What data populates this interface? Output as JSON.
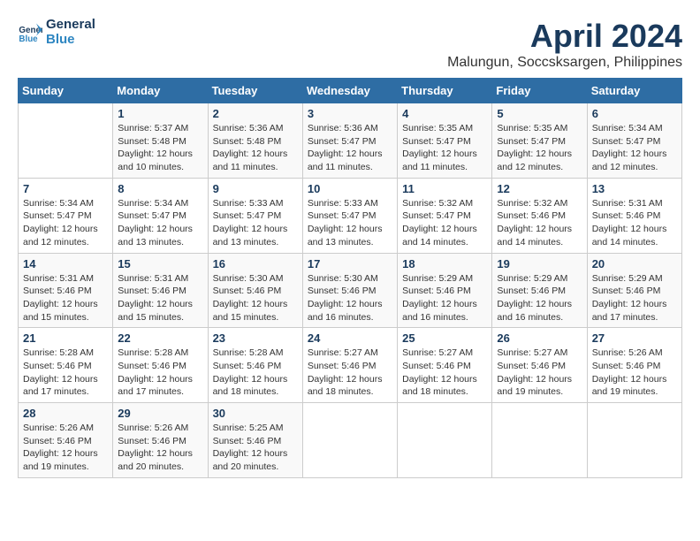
{
  "header": {
    "logo_line1": "General",
    "logo_line2": "Blue",
    "month": "April 2024",
    "location": "Malungun, Soccsksargen, Philippines"
  },
  "weekdays": [
    "Sunday",
    "Monday",
    "Tuesday",
    "Wednesday",
    "Thursday",
    "Friday",
    "Saturday"
  ],
  "weeks": [
    [
      {
        "day": "",
        "sunrise": "",
        "sunset": "",
        "daylight": ""
      },
      {
        "day": "1",
        "sunrise": "Sunrise: 5:37 AM",
        "sunset": "Sunset: 5:48 PM",
        "daylight": "Daylight: 12 hours and 10 minutes."
      },
      {
        "day": "2",
        "sunrise": "Sunrise: 5:36 AM",
        "sunset": "Sunset: 5:48 PM",
        "daylight": "Daylight: 12 hours and 11 minutes."
      },
      {
        "day": "3",
        "sunrise": "Sunrise: 5:36 AM",
        "sunset": "Sunset: 5:47 PM",
        "daylight": "Daylight: 12 hours and 11 minutes."
      },
      {
        "day": "4",
        "sunrise": "Sunrise: 5:35 AM",
        "sunset": "Sunset: 5:47 PM",
        "daylight": "Daylight: 12 hours and 11 minutes."
      },
      {
        "day": "5",
        "sunrise": "Sunrise: 5:35 AM",
        "sunset": "Sunset: 5:47 PM",
        "daylight": "Daylight: 12 hours and 12 minutes."
      },
      {
        "day": "6",
        "sunrise": "Sunrise: 5:34 AM",
        "sunset": "Sunset: 5:47 PM",
        "daylight": "Daylight: 12 hours and 12 minutes."
      }
    ],
    [
      {
        "day": "7",
        "sunrise": "Sunrise: 5:34 AM",
        "sunset": "Sunset: 5:47 PM",
        "daylight": "Daylight: 12 hours and 12 minutes."
      },
      {
        "day": "8",
        "sunrise": "Sunrise: 5:34 AM",
        "sunset": "Sunset: 5:47 PM",
        "daylight": "Daylight: 12 hours and 13 minutes."
      },
      {
        "day": "9",
        "sunrise": "Sunrise: 5:33 AM",
        "sunset": "Sunset: 5:47 PM",
        "daylight": "Daylight: 12 hours and 13 minutes."
      },
      {
        "day": "10",
        "sunrise": "Sunrise: 5:33 AM",
        "sunset": "Sunset: 5:47 PM",
        "daylight": "Daylight: 12 hours and 13 minutes."
      },
      {
        "day": "11",
        "sunrise": "Sunrise: 5:32 AM",
        "sunset": "Sunset: 5:47 PM",
        "daylight": "Daylight: 12 hours and 14 minutes."
      },
      {
        "day": "12",
        "sunrise": "Sunrise: 5:32 AM",
        "sunset": "Sunset: 5:46 PM",
        "daylight": "Daylight: 12 hours and 14 minutes."
      },
      {
        "day": "13",
        "sunrise": "Sunrise: 5:31 AM",
        "sunset": "Sunset: 5:46 PM",
        "daylight": "Daylight: 12 hours and 14 minutes."
      }
    ],
    [
      {
        "day": "14",
        "sunrise": "Sunrise: 5:31 AM",
        "sunset": "Sunset: 5:46 PM",
        "daylight": "Daylight: 12 hours and 15 minutes."
      },
      {
        "day": "15",
        "sunrise": "Sunrise: 5:31 AM",
        "sunset": "Sunset: 5:46 PM",
        "daylight": "Daylight: 12 hours and 15 minutes."
      },
      {
        "day": "16",
        "sunrise": "Sunrise: 5:30 AM",
        "sunset": "Sunset: 5:46 PM",
        "daylight": "Daylight: 12 hours and 15 minutes."
      },
      {
        "day": "17",
        "sunrise": "Sunrise: 5:30 AM",
        "sunset": "Sunset: 5:46 PM",
        "daylight": "Daylight: 12 hours and 16 minutes."
      },
      {
        "day": "18",
        "sunrise": "Sunrise: 5:29 AM",
        "sunset": "Sunset: 5:46 PM",
        "daylight": "Daylight: 12 hours and 16 minutes."
      },
      {
        "day": "19",
        "sunrise": "Sunrise: 5:29 AM",
        "sunset": "Sunset: 5:46 PM",
        "daylight": "Daylight: 12 hours and 16 minutes."
      },
      {
        "day": "20",
        "sunrise": "Sunrise: 5:29 AM",
        "sunset": "Sunset: 5:46 PM",
        "daylight": "Daylight: 12 hours and 17 minutes."
      }
    ],
    [
      {
        "day": "21",
        "sunrise": "Sunrise: 5:28 AM",
        "sunset": "Sunset: 5:46 PM",
        "daylight": "Daylight: 12 hours and 17 minutes."
      },
      {
        "day": "22",
        "sunrise": "Sunrise: 5:28 AM",
        "sunset": "Sunset: 5:46 PM",
        "daylight": "Daylight: 12 hours and 17 minutes."
      },
      {
        "day": "23",
        "sunrise": "Sunrise: 5:28 AM",
        "sunset": "Sunset: 5:46 PM",
        "daylight": "Daylight: 12 hours and 18 minutes."
      },
      {
        "day": "24",
        "sunrise": "Sunrise: 5:27 AM",
        "sunset": "Sunset: 5:46 PM",
        "daylight": "Daylight: 12 hours and 18 minutes."
      },
      {
        "day": "25",
        "sunrise": "Sunrise: 5:27 AM",
        "sunset": "Sunset: 5:46 PM",
        "daylight": "Daylight: 12 hours and 18 minutes."
      },
      {
        "day": "26",
        "sunrise": "Sunrise: 5:27 AM",
        "sunset": "Sunset: 5:46 PM",
        "daylight": "Daylight: 12 hours and 19 minutes."
      },
      {
        "day": "27",
        "sunrise": "Sunrise: 5:26 AM",
        "sunset": "Sunset: 5:46 PM",
        "daylight": "Daylight: 12 hours and 19 minutes."
      }
    ],
    [
      {
        "day": "28",
        "sunrise": "Sunrise: 5:26 AM",
        "sunset": "Sunset: 5:46 PM",
        "daylight": "Daylight: 12 hours and 19 minutes."
      },
      {
        "day": "29",
        "sunrise": "Sunrise: 5:26 AM",
        "sunset": "Sunset: 5:46 PM",
        "daylight": "Daylight: 12 hours and 20 minutes."
      },
      {
        "day": "30",
        "sunrise": "Sunrise: 5:25 AM",
        "sunset": "Sunset: 5:46 PM",
        "daylight": "Daylight: 12 hours and 20 minutes."
      },
      {
        "day": "",
        "sunrise": "",
        "sunset": "",
        "daylight": ""
      },
      {
        "day": "",
        "sunrise": "",
        "sunset": "",
        "daylight": ""
      },
      {
        "day": "",
        "sunrise": "",
        "sunset": "",
        "daylight": ""
      },
      {
        "day": "",
        "sunrise": "",
        "sunset": "",
        "daylight": ""
      }
    ]
  ]
}
